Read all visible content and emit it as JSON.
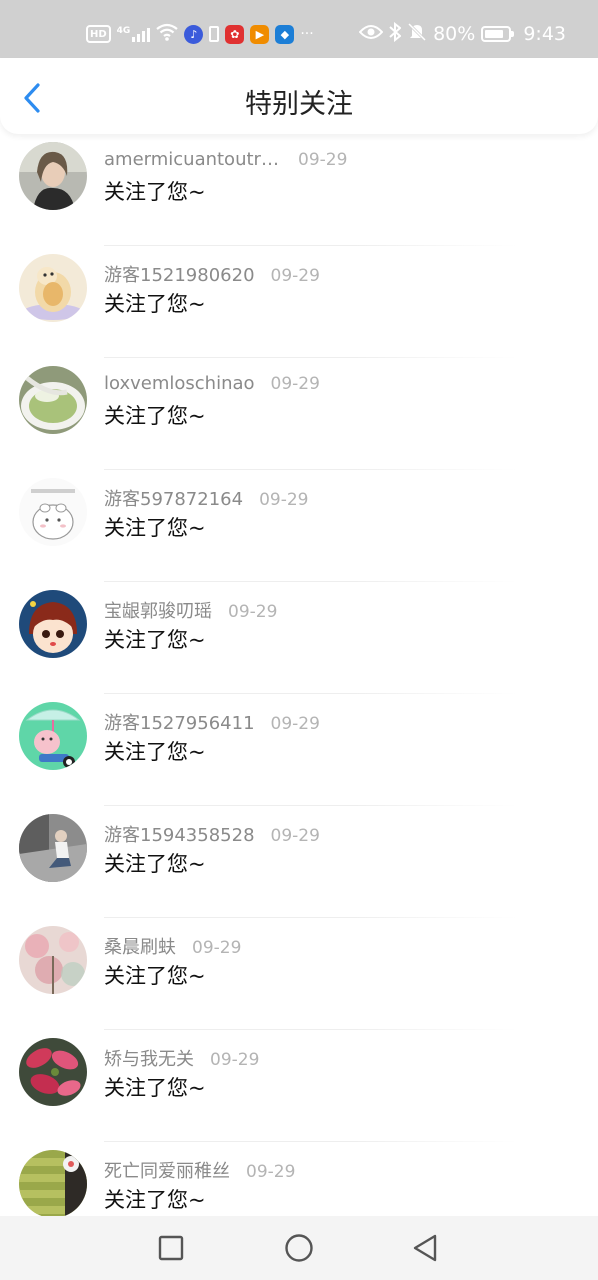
{
  "status_bar": {
    "battery_text": "80%",
    "battery_level": 0.8,
    "time": "9:43",
    "hd_badge": "HD",
    "network": "4G",
    "overflow": "···"
  },
  "header": {
    "title": "特别关注"
  },
  "items": [
    {
      "name": "amermicuantoutri...",
      "date": "09-29",
      "message": "关注了您~",
      "avatar": "portrait-woman"
    },
    {
      "name": "游客1521980620",
      "date": "09-29",
      "message": "关注了您~",
      "avatar": "cartoon-hamster"
    },
    {
      "name": "loxvemloschinao",
      "date": "09-29",
      "message": "关注了您~",
      "avatar": "soup-bowl"
    },
    {
      "name": "游客597872164",
      "date": "09-29",
      "message": "关注了您~",
      "avatar": "sketch-hamster"
    },
    {
      "name": "宝龈郭骏叨瑶",
      "date": "09-29",
      "message": "关注了您~",
      "avatar": "cartoon-girl"
    },
    {
      "name": "游客1527956411",
      "date": "09-29",
      "message": "关注了您~",
      "avatar": "pig-umbrella"
    },
    {
      "name": "游客1594358528",
      "date": "09-29",
      "message": "关注了您~",
      "avatar": "sitting-man"
    },
    {
      "name": "桑晨刷蚨",
      "date": "09-29",
      "message": "关注了您~",
      "avatar": "pink-blossom"
    },
    {
      "name": "矫与我无关",
      "date": "09-29",
      "message": "关注了您~",
      "avatar": "red-leaves"
    },
    {
      "name": "死亡同爱丽稚丝",
      "date": "09-29",
      "message": "关注了您~",
      "avatar": "brick-wall"
    }
  ],
  "colors": {
    "accent": "#2d8cf0",
    "status_bar_bg": "#d0d0d0",
    "name": "#8a8a8a",
    "date": "#b4b4b4",
    "message": "#111111"
  }
}
